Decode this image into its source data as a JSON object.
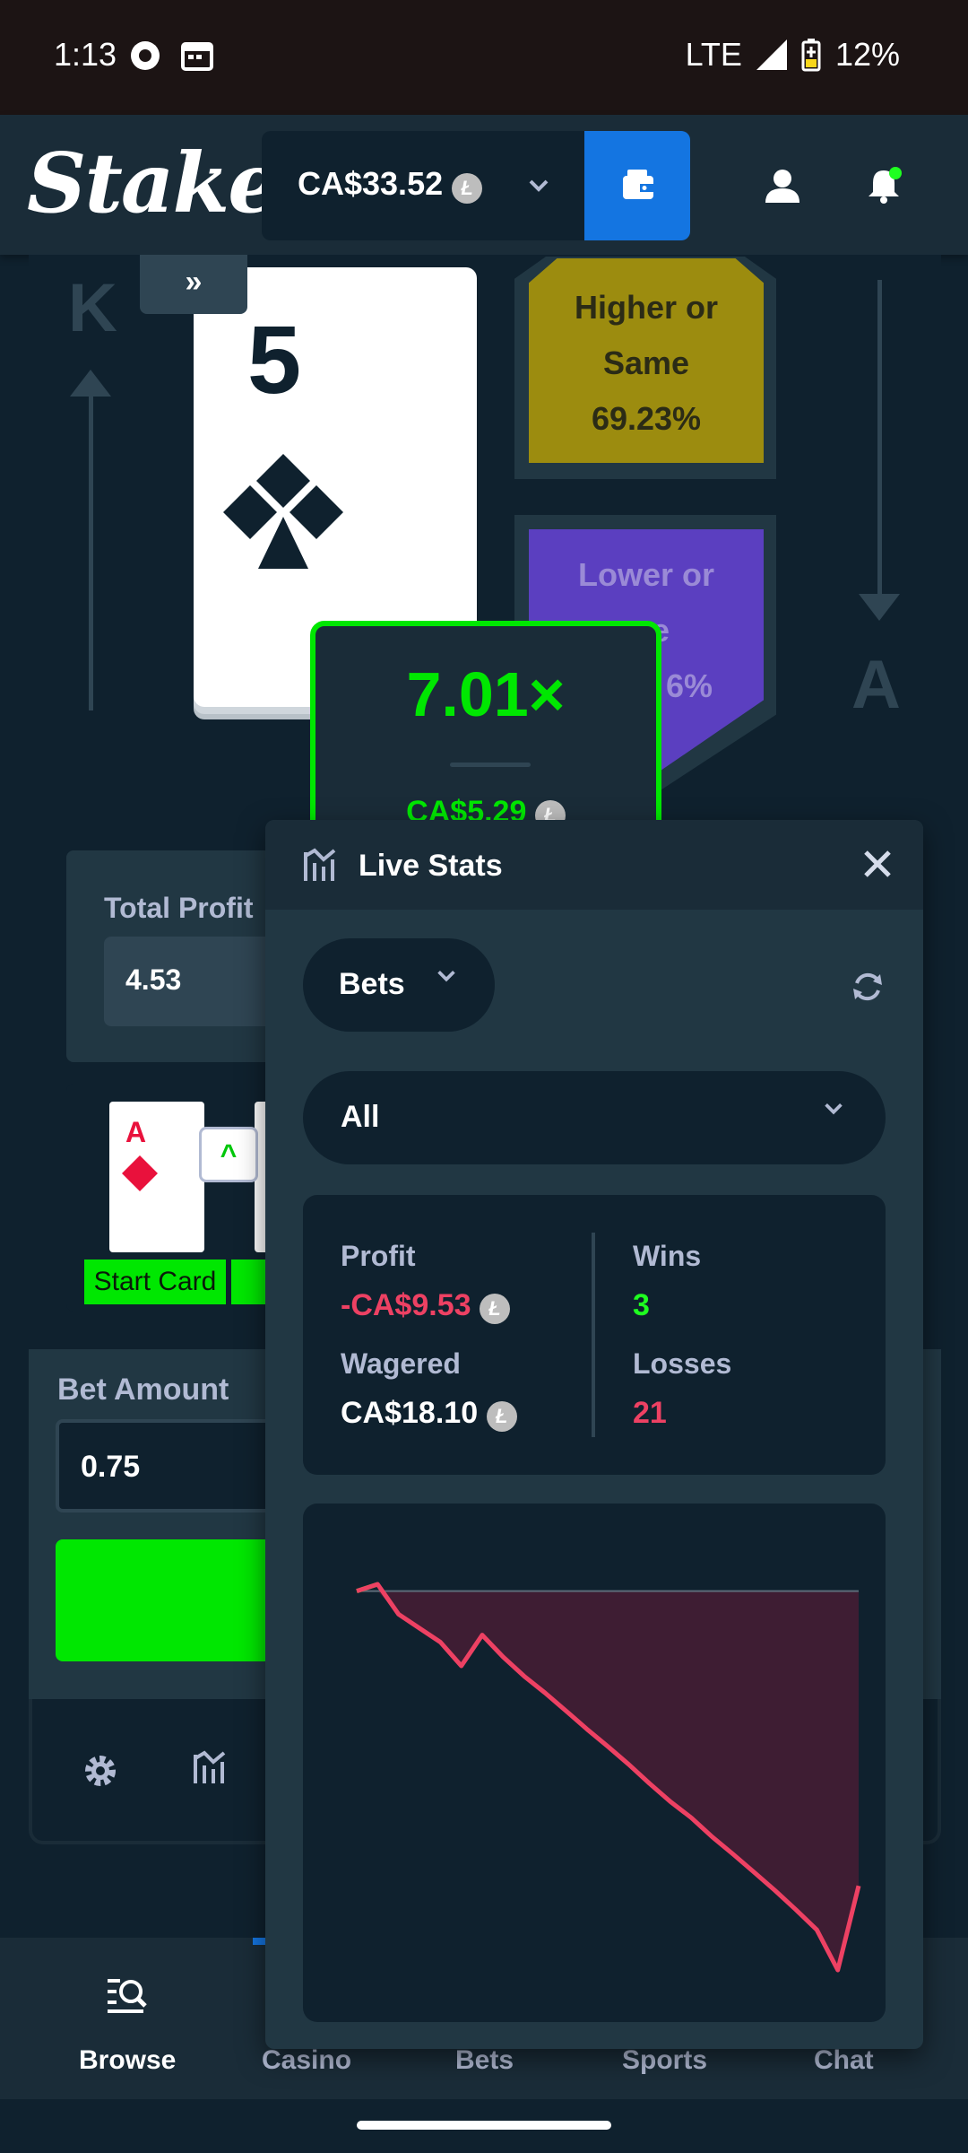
{
  "status_bar": {
    "time": "1:13",
    "network": "LTE",
    "battery": "12%"
  },
  "header": {
    "logo": "Stake",
    "balance": "CA$33.52",
    "coin_symbol": "Ł"
  },
  "game": {
    "card_rank": "5",
    "top_rank": "K",
    "bottom_rank": "A",
    "skip_label": "»",
    "higher": {
      "line1": "Higher or",
      "line2": "Same",
      "pct": "69.23%"
    },
    "lower": {
      "line1": "Lower or",
      "line2": "me",
      "pct": "6%"
    },
    "multiplier": "7.01×",
    "multiplier_profit": "CA$5.29"
  },
  "profit_panel": {
    "label": "Total Profit",
    "value": "4.53"
  },
  "history": {
    "card_rank": "A",
    "start_label": "Start Card",
    "up_symbol": "^"
  },
  "bet": {
    "label": "Bet Amount",
    "value": "0.75"
  },
  "bottom_nav": {
    "items": [
      {
        "label": "Browse"
      },
      {
        "label": "Casino"
      },
      {
        "label": "Bets"
      },
      {
        "label": "Sports"
      },
      {
        "label": "Chat"
      }
    ]
  },
  "live_stats": {
    "title": "Live Stats",
    "filter_bets": "Bets",
    "filter_all": "All",
    "profit_label": "Profit",
    "profit_value": "-CA$9.53",
    "wagered_label": "Wagered",
    "wagered_value": "CA$18.10",
    "wins_label": "Wins",
    "wins_value": "3",
    "losses_label": "Losses",
    "losses_value": "21"
  },
  "colors": {
    "bg": "#0f212e",
    "accent_green": "#00e701",
    "accent_blue": "#1475e1",
    "loss_red": "#ed4163",
    "higher_gold": "#9c8c0f",
    "lower_purple": "#5b3fc0"
  },
  "chart_data": {
    "type": "area",
    "x": [
      0,
      1,
      2,
      3,
      4,
      5,
      6,
      7,
      8,
      9,
      10,
      11,
      12,
      13,
      14,
      15,
      16,
      17,
      18,
      19,
      20,
      21,
      22,
      23,
      24
    ],
    "values": [
      0,
      0.22,
      -0.75,
      -1.2,
      -1.65,
      -2.42,
      -1.42,
      -2.13,
      -2.75,
      -3.29,
      -3.87,
      -4.46,
      -5.02,
      -5.6,
      -6.22,
      -6.81,
      -7.33,
      -7.95,
      -8.51,
      -9.09,
      -9.68,
      -10.3,
      -10.95,
      -12.25,
      -9.53
    ]
  }
}
